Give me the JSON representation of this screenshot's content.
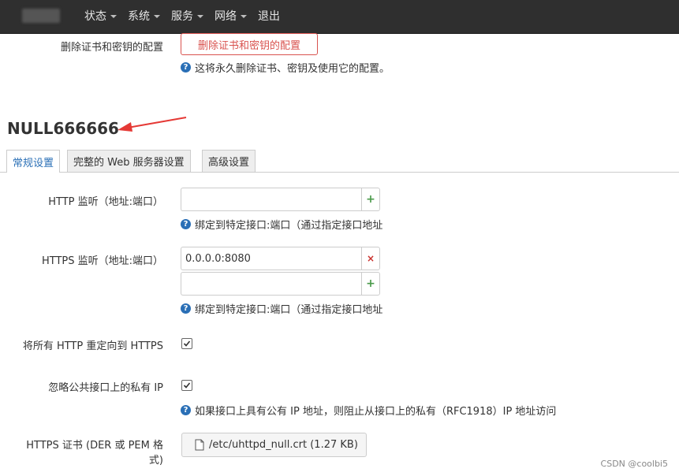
{
  "nav": {
    "items": [
      {
        "label": "状态",
        "caret": true
      },
      {
        "label": "系统",
        "caret": true
      },
      {
        "label": "服务",
        "caret": true
      },
      {
        "label": "网络",
        "caret": true
      },
      {
        "label": "退出",
        "caret": false
      }
    ]
  },
  "delete_config": {
    "label": "删除证书和密钥的配置",
    "button": "删除证书和密钥的配置",
    "help": "这将永久删除证书、密钥及使用它的配置。"
  },
  "section": {
    "title": "NULL666666",
    "arrow_color": "#e53935"
  },
  "tabs": [
    {
      "label": "常规设置",
      "active": true
    },
    {
      "label": "完整的 Web 服务器设置",
      "active": false
    },
    {
      "label": "高级设置",
      "active": false
    }
  ],
  "http_listen": {
    "label": "HTTP 监听（地址:端口）",
    "value": "",
    "add_symbol": "+",
    "help": "绑定到特定接口:端口（通过指定接口地址"
  },
  "https_listen": {
    "label": "HTTPS 监听（地址:端口）",
    "values": [
      "0.0.0.0:8080",
      ""
    ],
    "remove_symbol": "×",
    "add_symbol": "+",
    "help": "绑定到特定接口:端口（通过指定接口地址"
  },
  "redirect_https": {
    "label": "将所有 HTTP 重定向到 HTTPS",
    "checked": true
  },
  "ignore_private": {
    "label": "忽略公共接口上的私有 IP",
    "checked": true,
    "help": "如果接口上具有公有 IP 地址，则阻止从接口上的私有（RFC1918）IP 地址访问"
  },
  "https_cert": {
    "label_line1": "HTTPS 证书 (DER 或 PEM 格",
    "label_line2": "式)",
    "file": "/etc/uhttpd_null.crt (1.27 KB)"
  },
  "watermark": "CSDN @coolbi5",
  "colors": {
    "navbar": "#2f2f2f",
    "danger": "#d9534f",
    "accent": "#2a6fb6",
    "add": "#4a9a4a",
    "remove": "#c9302c"
  }
}
